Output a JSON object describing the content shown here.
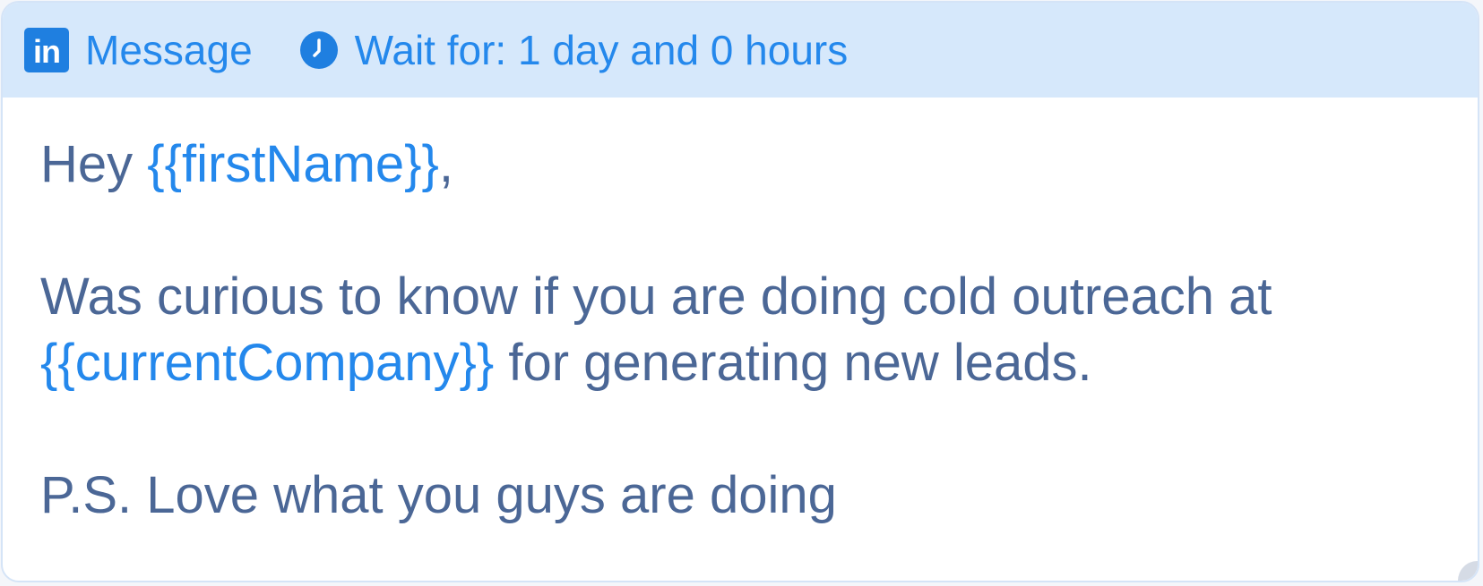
{
  "header": {
    "channel_icon": "linkedin-icon",
    "channel_icon_text": "in",
    "channel_label": "Message",
    "wait_icon": "clock-icon",
    "wait_label": "Wait for: 1 day and 0 hours"
  },
  "message": {
    "greeting_prefix": "Hey ",
    "greeting_variable": "{{firstName}}",
    "greeting_suffix": ",",
    "line1_text": "Was curious to know if you are doing cold outreach at",
    "line2_variable": "{{currentCompany}}",
    "line2_text": " for generating new leads.",
    "ps_text": "P.S. Love what you guys are doing"
  },
  "colors": {
    "accent": "#2488ec",
    "header_bg": "#d6e8fb",
    "body_text": "#4b6796"
  }
}
